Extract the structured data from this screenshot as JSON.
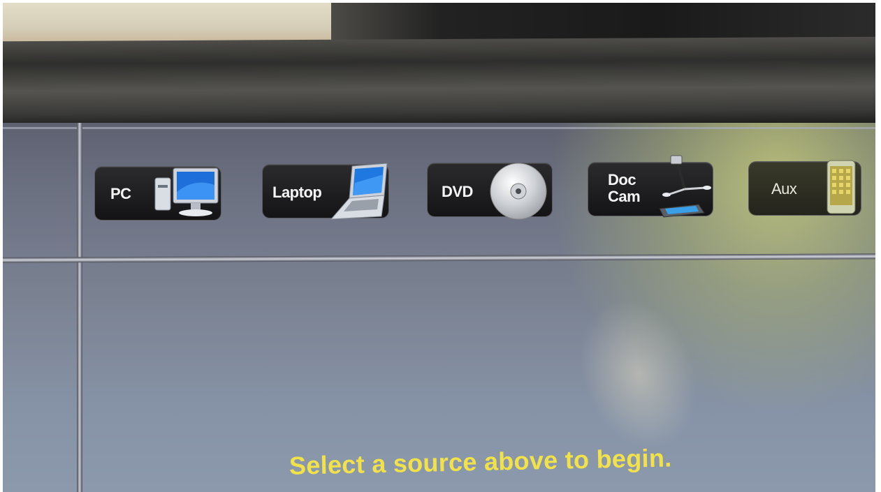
{
  "sources": [
    {
      "label": "PC",
      "icon": "desktop-computer-icon"
    },
    {
      "label": "Laptop",
      "icon": "laptop-icon"
    },
    {
      "label": "DVD",
      "icon": "disc-icon"
    },
    {
      "label_line1": "Doc",
      "label_line2": "Cam",
      "icon": "document-camera-icon"
    },
    {
      "label": "Aux",
      "icon": "phone-icon"
    }
  ],
  "main": {
    "instruction": "Select a source above to begin."
  },
  "colors": {
    "instruction": "#f2e24a",
    "button": "#1c1c1e",
    "screen": "#7c8494"
  }
}
